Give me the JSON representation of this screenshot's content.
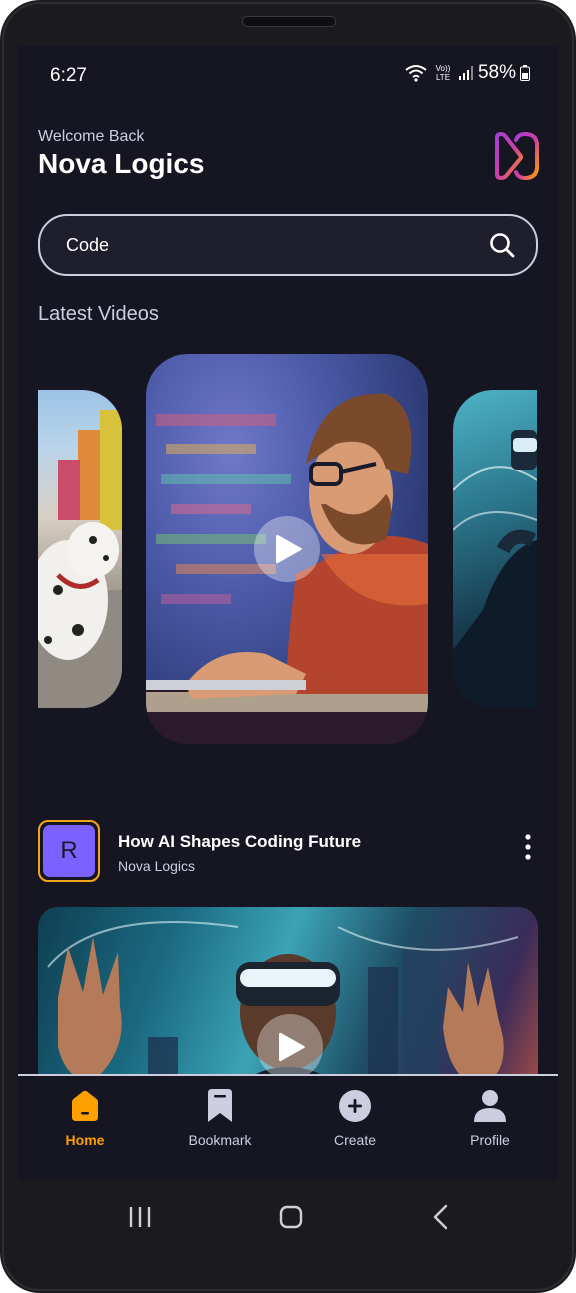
{
  "status_bar": {
    "time": "6:27",
    "network_badge_top": "Vo))",
    "network_badge_bottom": "LTE",
    "battery": "58%"
  },
  "header": {
    "welcome": "Welcome Back",
    "username": "Nova Logics",
    "logo_icon": "app-logo-icon"
  },
  "search": {
    "value": "Code",
    "icon": "search-icon"
  },
  "latest": {
    "title": "Latest Videos",
    "cards": [
      {
        "subject": "dalmatian dog on street"
      },
      {
        "subject": "man coding at laptop",
        "play": true
      },
      {
        "subject": "person in vr headset"
      }
    ]
  },
  "video": {
    "avatar_letter": "R",
    "title": "How AI Shapes Coding Future",
    "channel": "Nova Logics",
    "menu_icon": "more-vertical-icon"
  },
  "tabs": [
    {
      "label": "Home",
      "icon": "home-icon",
      "active": true
    },
    {
      "label": "Bookmark",
      "icon": "bookmark-icon",
      "active": false
    },
    {
      "label": "Create",
      "icon": "plus-circle-icon",
      "active": false
    },
    {
      "label": "Profile",
      "icon": "profile-icon",
      "active": false
    }
  ],
  "colors": {
    "background": "#161622",
    "accent": "#ffa001",
    "avatar": "#7b61ff",
    "muted_text": "#cdcde0"
  }
}
